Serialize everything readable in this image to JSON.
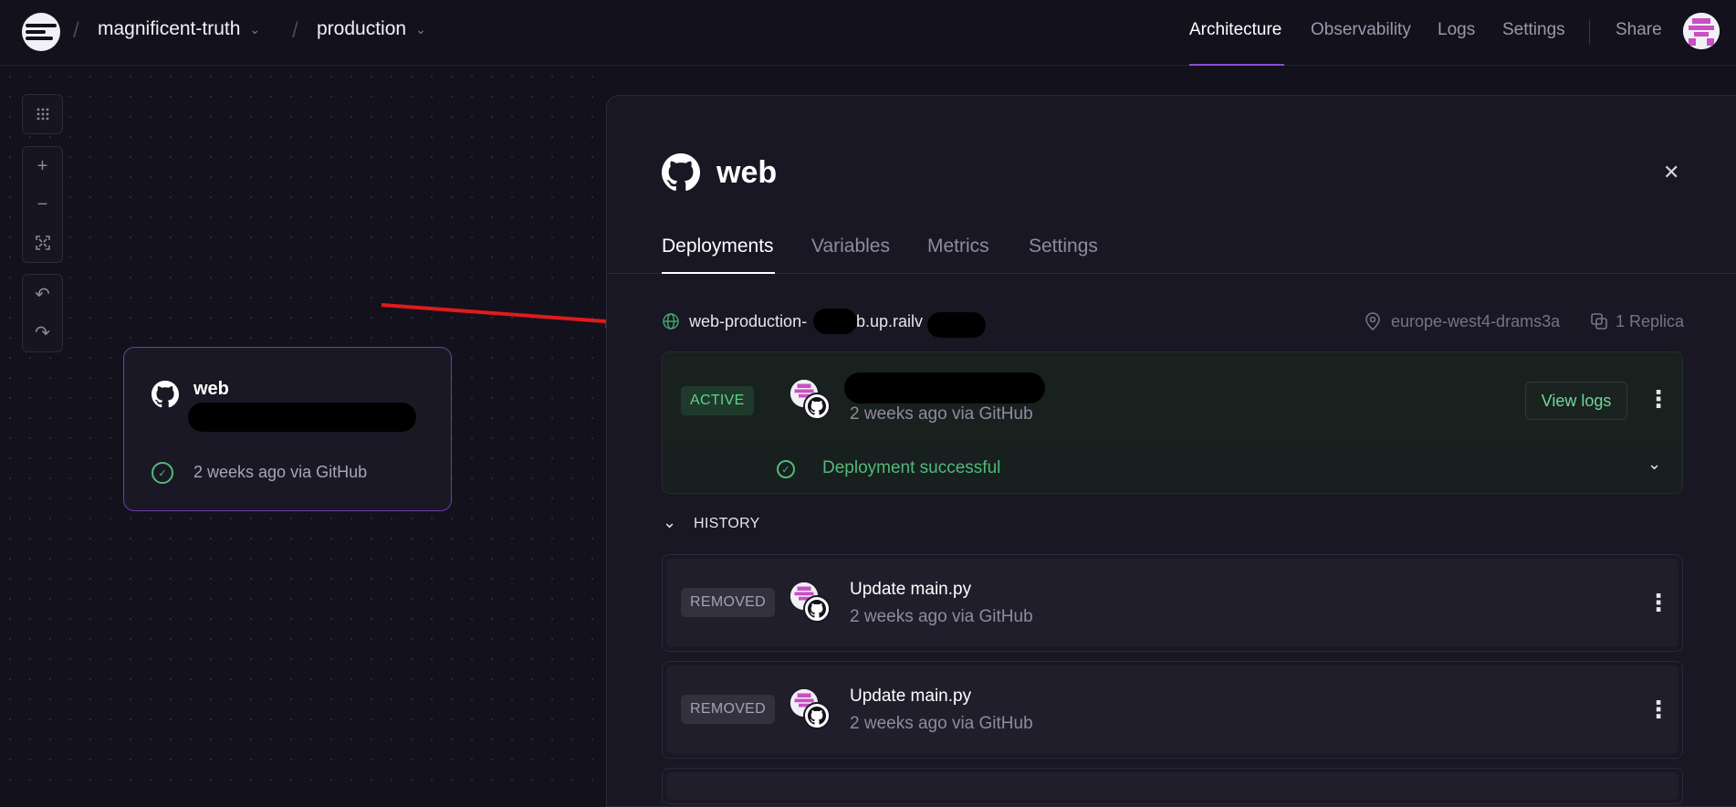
{
  "header": {
    "project": "magnificent-truth",
    "environment": "production",
    "nav": [
      "Architecture",
      "Observability",
      "Logs",
      "Settings"
    ],
    "share": "Share"
  },
  "canvas": {
    "service_card": {
      "name": "web",
      "status": "2 weeks ago via GitHub"
    }
  },
  "panel": {
    "title": "web",
    "tabs": [
      "Deployments",
      "Variables",
      "Metrics",
      "Settings"
    ],
    "url": "web-production-",
    "url_suffix": "b.up.railv",
    "region": "europe-west4-drams3a",
    "replicas": "1 Replica",
    "active_deployment": {
      "badge": "ACTIVE",
      "meta": "2 weeks ago via GitHub",
      "view_logs": "View logs",
      "status": "Deployment successful"
    },
    "history_label": "HISTORY",
    "history": [
      {
        "badge": "REMOVED",
        "commit": "Update main.py",
        "meta": "2 weeks ago via GitHub"
      },
      {
        "badge": "REMOVED",
        "commit": "Update main.py",
        "meta": "2 weeks ago via GitHub"
      }
    ]
  },
  "colors": {
    "background": "#13111c",
    "panel": "#191724",
    "accent": "#8b4fd8",
    "success": "#52b979",
    "arrow": "#e01b1b"
  }
}
